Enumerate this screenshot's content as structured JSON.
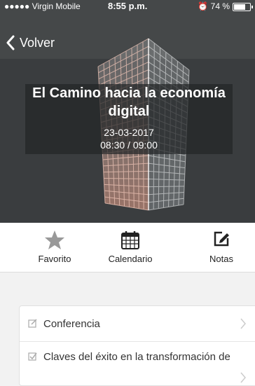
{
  "status_bar": {
    "carrier": "●●●●● Virgin Mobile",
    "time": "8:55 p.m.",
    "battery": "74 %",
    "battery_level": 0.74
  },
  "nav": {
    "back_label": "Volver"
  },
  "event": {
    "title": "El Camino hacia la economía digital",
    "date": "23-03-2017",
    "time": "08:30 / 09:00"
  },
  "actions": [
    {
      "label": "Favorito",
      "icon": "star-icon"
    },
    {
      "label": "Calendario",
      "icon": "calendar-icon"
    },
    {
      "label": "Notas",
      "icon": "note-edit-icon"
    }
  ],
  "list": [
    {
      "label": "Conferencia",
      "icon": "edit-icon"
    },
    {
      "label": "Claves del éxito en la transformación de",
      "icon": "checkbox-icon"
    }
  ],
  "colors": {
    "header_bg": "#3a3d3f",
    "icon_gray": "#999999"
  }
}
